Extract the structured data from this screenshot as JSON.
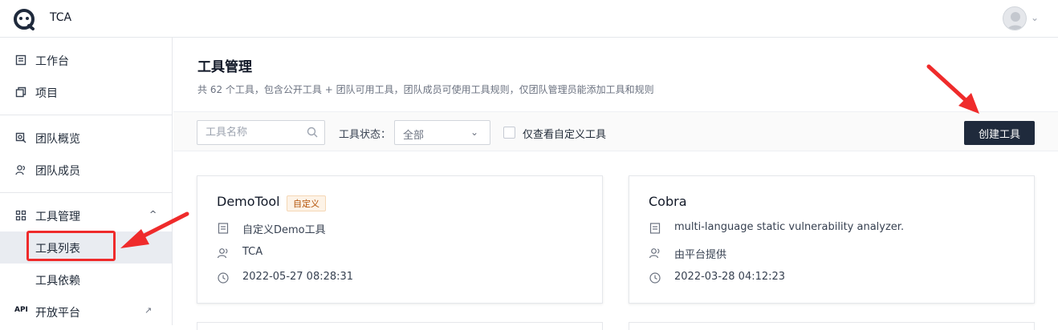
{
  "app": {
    "name": "TCA"
  },
  "sidebar": {
    "items": [
      {
        "label": "工作台",
        "icon": "dashboard-icon"
      },
      {
        "label": "项目",
        "icon": "project-icon"
      },
      {
        "label": "团队概览",
        "icon": "team-overview-icon"
      },
      {
        "label": "团队成员",
        "icon": "members-icon"
      },
      {
        "label": "工具管理",
        "icon": "grid-icon"
      }
    ],
    "tool_sub": [
      {
        "label": "工具列表",
        "active": true
      },
      {
        "label": "工具依赖",
        "active": false
      }
    ],
    "open_platform": {
      "badge": "API",
      "label": "开放平台"
    }
  },
  "main": {
    "title": "工具管理",
    "description": "共 62 个工具，包含公开工具 + 团队可用工具，团队成员可使用工具规则，仅团队管理员能添加工具和规则",
    "filters": {
      "search_placeholder": "工具名称",
      "status_label": "工具状态：",
      "status_value": "全部",
      "custom_only_label": "仅查看自定义工具",
      "create_button": "创建工具"
    },
    "cards": [
      {
        "title": "DemoTool",
        "tag": "自定义",
        "description": "自定义Demo工具",
        "owner": "TCA",
        "time": "2022-05-27 08:28:31"
      },
      {
        "title": "Cobra",
        "tag": "",
        "description": "multi-language static vulnerability analyzer.",
        "owner": "由平台提供",
        "time": "2022-03-28 04:12:23"
      }
    ]
  },
  "colors": {
    "primary_button": "#1f2a3c",
    "annotation_red": "#ef2b2b",
    "tag_text": "#b45309",
    "active_bg": "#e9ecf1"
  }
}
